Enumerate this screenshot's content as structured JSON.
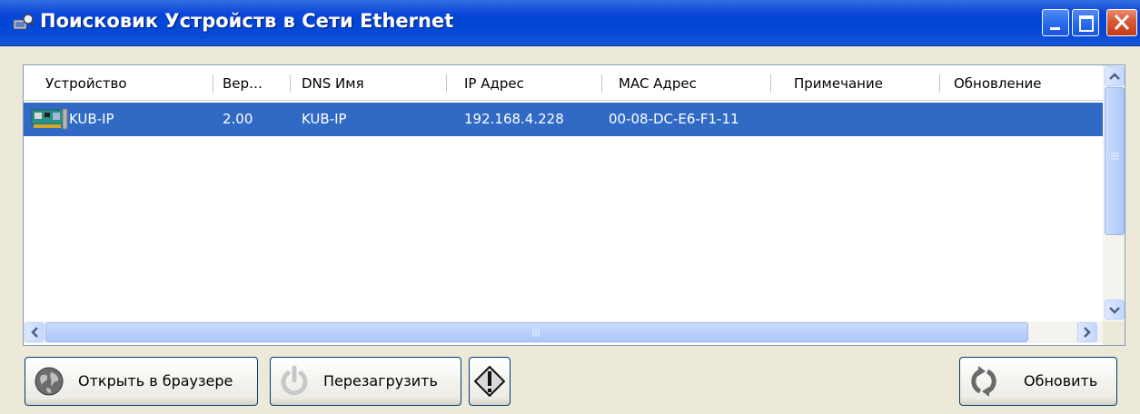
{
  "window": {
    "title": "Поисковик Устройств в Сети Ethernet",
    "icons": {
      "app": "network-search-icon",
      "minimize": "minimize-icon",
      "maximize": "maximize-icon",
      "close": "close-icon"
    }
  },
  "table": {
    "columns": [
      "Устройство",
      "Вер…",
      "DNS Имя",
      "IP Адрес",
      "MAC Адрес",
      "Примечание",
      "Обновление"
    ],
    "rows": [
      {
        "icon": "network-card-icon",
        "device": "KUB-IP",
        "version": "2.00",
        "dns": "KUB-IP",
        "ip": "192.168.4.228",
        "mac": "00-08-DC-E6-F1-11",
        "note": "",
        "update": "",
        "selected": true
      }
    ]
  },
  "buttons": {
    "open_browser": {
      "label": "Открыть в браузере",
      "icon": "globe-icon"
    },
    "restart": {
      "label": "Перезагрузить",
      "icon": "power-icon"
    },
    "info": {
      "label": "",
      "icon": "exclamation-icon"
    },
    "refresh": {
      "label": "Обновить",
      "icon": "refresh-icon"
    }
  },
  "colors": {
    "titlebar": "#0046d5",
    "selection": "#316ac5",
    "close_button": "#dc5b39",
    "window_bg": "#ece9d8"
  }
}
